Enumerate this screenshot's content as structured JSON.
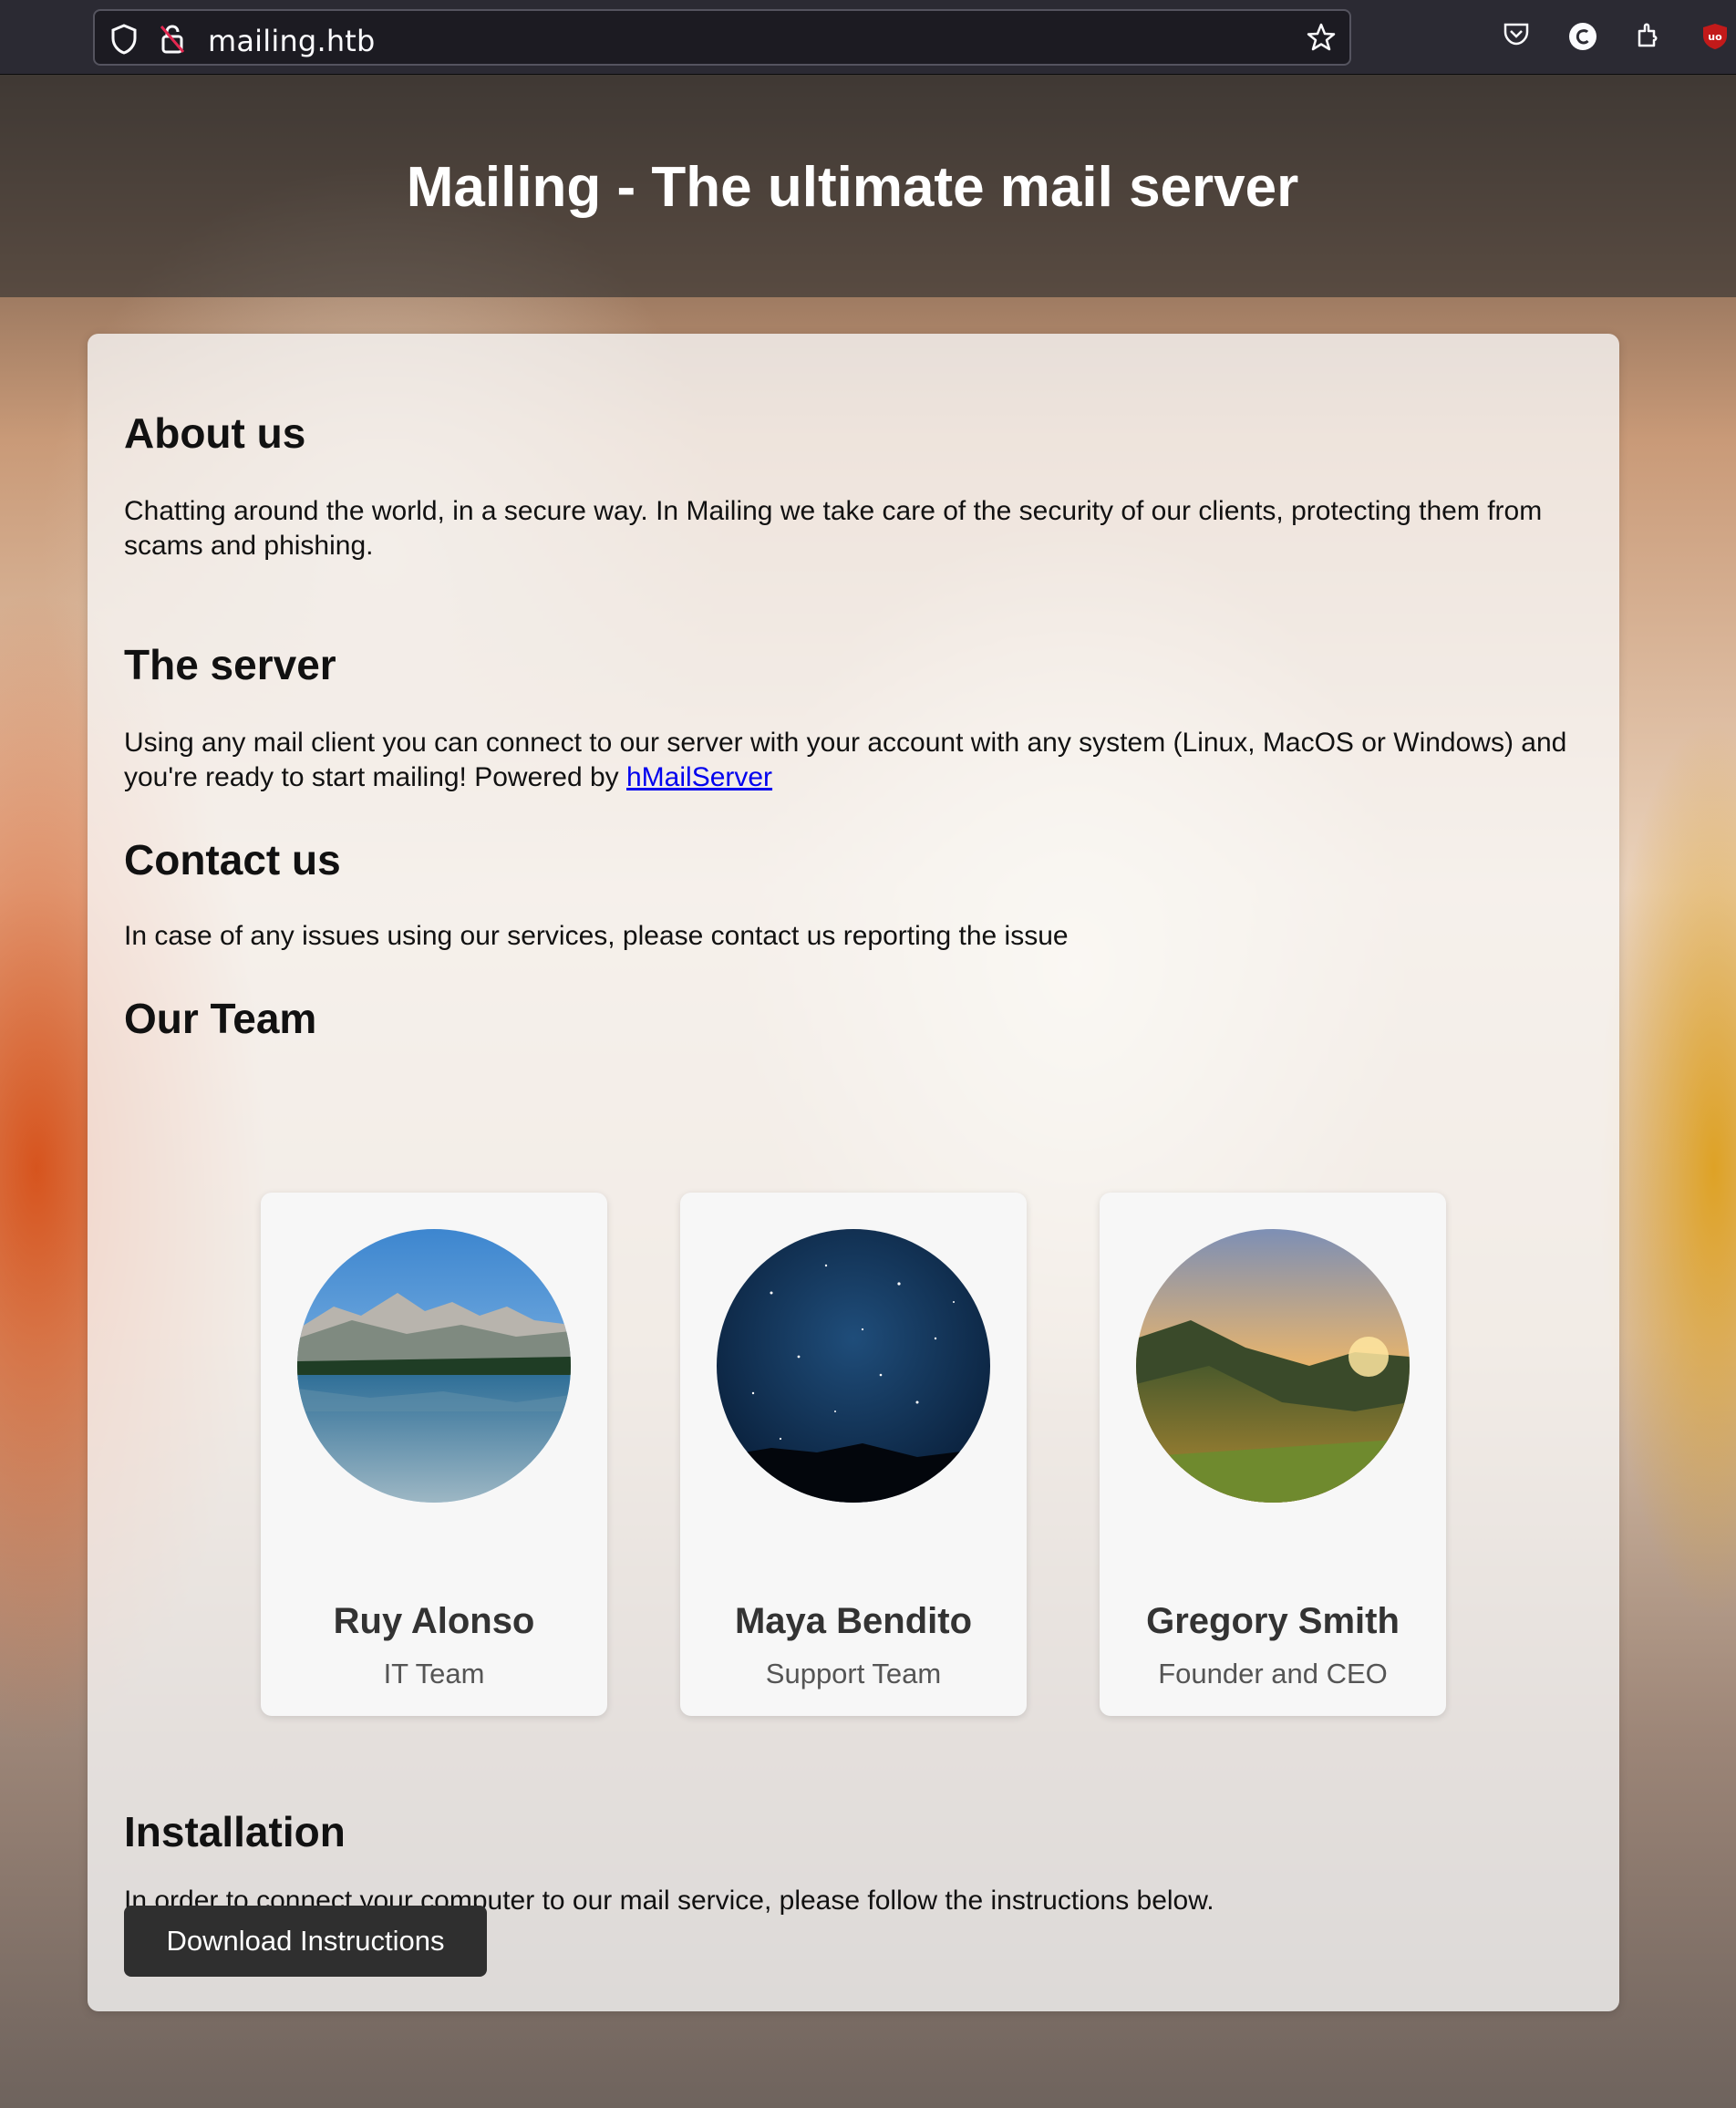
{
  "browser": {
    "url": "mailing.htb",
    "icons": [
      "shield-icon",
      "insecure-lock-icon",
      "bookmark-star-icon",
      "pocket-icon",
      "account-icon",
      "extensions-icon",
      "ublock-icon"
    ]
  },
  "header": {
    "title": "Mailing - The ultimate mail server"
  },
  "sections": {
    "about": {
      "heading": "About us",
      "text": "Chatting around the world, in a secure way. In Mailing we take care of the security of our clients, protecting them from scams and phishing."
    },
    "server": {
      "heading": "The server",
      "text": "Using any mail client you can connect to our server with your account with any system (Linux, MacOS or Windows) and you're ready to start mailing! Powered by ",
      "link": "hMailServer"
    },
    "contact": {
      "heading": "Contact us",
      "text": "In case of any issues using our services, please contact us reporting the issue"
    },
    "team": {
      "heading": "Our Team",
      "members": [
        {
          "name": "Ruy Alonso",
          "role": "IT Team",
          "photo": "mountain-lake-photo"
        },
        {
          "name": "Maya Bendito",
          "role": "Support Team",
          "photo": "starry-night-photo"
        },
        {
          "name": "Gregory Smith",
          "role": "Founder and CEO",
          "photo": "sunset-valley-photo"
        }
      ]
    },
    "installation": {
      "heading": "Installation",
      "text": "In order to connect your computer to our mail service, please follow the instructions below.",
      "button": "Download Instructions"
    }
  },
  "colors": {
    "link": "#0000ee",
    "button_bg": "#2f2f2f",
    "header_overlay": "#2d2d2d"
  }
}
